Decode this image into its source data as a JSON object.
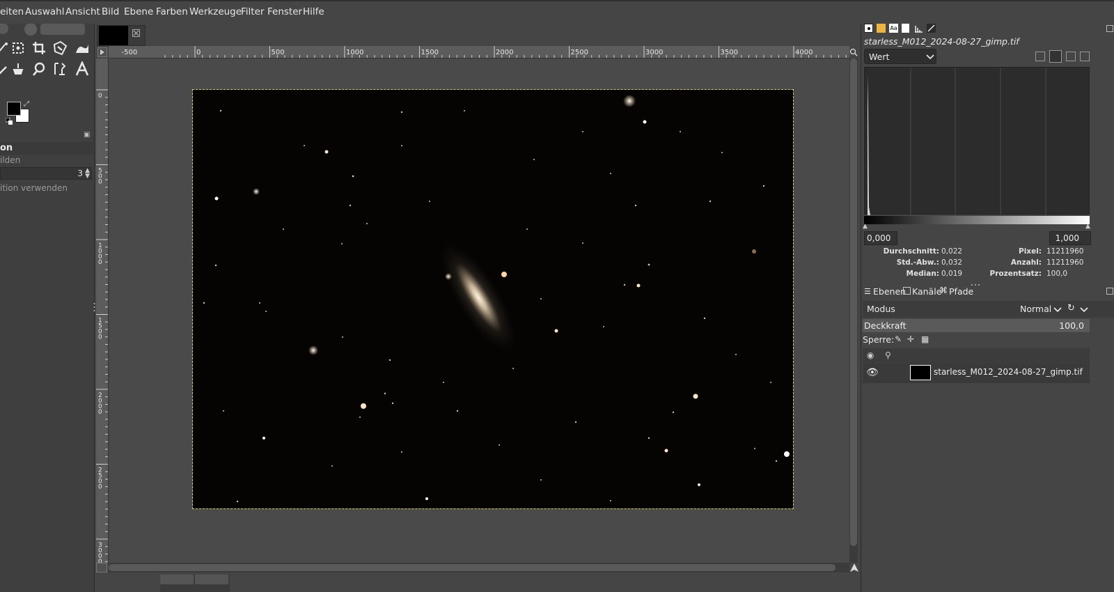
{
  "menubar": {
    "items": [
      "eiten",
      "Auswahl",
      "Ansicht",
      "Bild",
      "Ebene",
      "Farben",
      "Werkzeuge",
      "Filter",
      "Fenster",
      "Hilfe"
    ]
  },
  "tool_options": {
    "title": "on",
    "sub": "ilden",
    "value": "3",
    "option": "ition verwenden"
  },
  "rulers": {
    "horizontal": [
      "-500",
      "0",
      "500",
      "1000",
      "1500",
      "2000",
      "2500",
      "3000",
      "3500",
      "4000"
    ],
    "vertical": [
      "0",
      "500",
      "1000",
      "1500",
      "2000",
      "2500",
      "3000"
    ]
  },
  "histogram": {
    "filename": "starless_M012_2024-08-27_gimp.tif",
    "channel": "Wert",
    "range_min": "0,000",
    "range_max": "1,000",
    "stats_left": [
      {
        "label": "Durchschnitt:",
        "value": "0,022"
      },
      {
        "label": "Std.-Abw.:",
        "value": "0,032"
      },
      {
        "label": "Median:",
        "value": "0,019"
      }
    ],
    "stats_right": [
      {
        "label": "Pixel:",
        "value": "11211960"
      },
      {
        "label": "Anzahl:",
        "value": "11211960"
      },
      {
        "label": "Prozentsatz:",
        "value": "100,0"
      }
    ]
  },
  "layers": {
    "tabs": [
      "Ebenen",
      "Kanäle",
      "Pfade"
    ],
    "mode_label": "Modus",
    "mode_value": "Normal",
    "opacity_label": "Deckkraft",
    "opacity_value": "100,0",
    "lock_label": "Sperre:",
    "layer_name": "starless_M012_2024-08-27_gimp.tif"
  },
  "colors": {
    "fg": "#000000",
    "bg": "#ffffff",
    "selection": "#d8c94a"
  }
}
